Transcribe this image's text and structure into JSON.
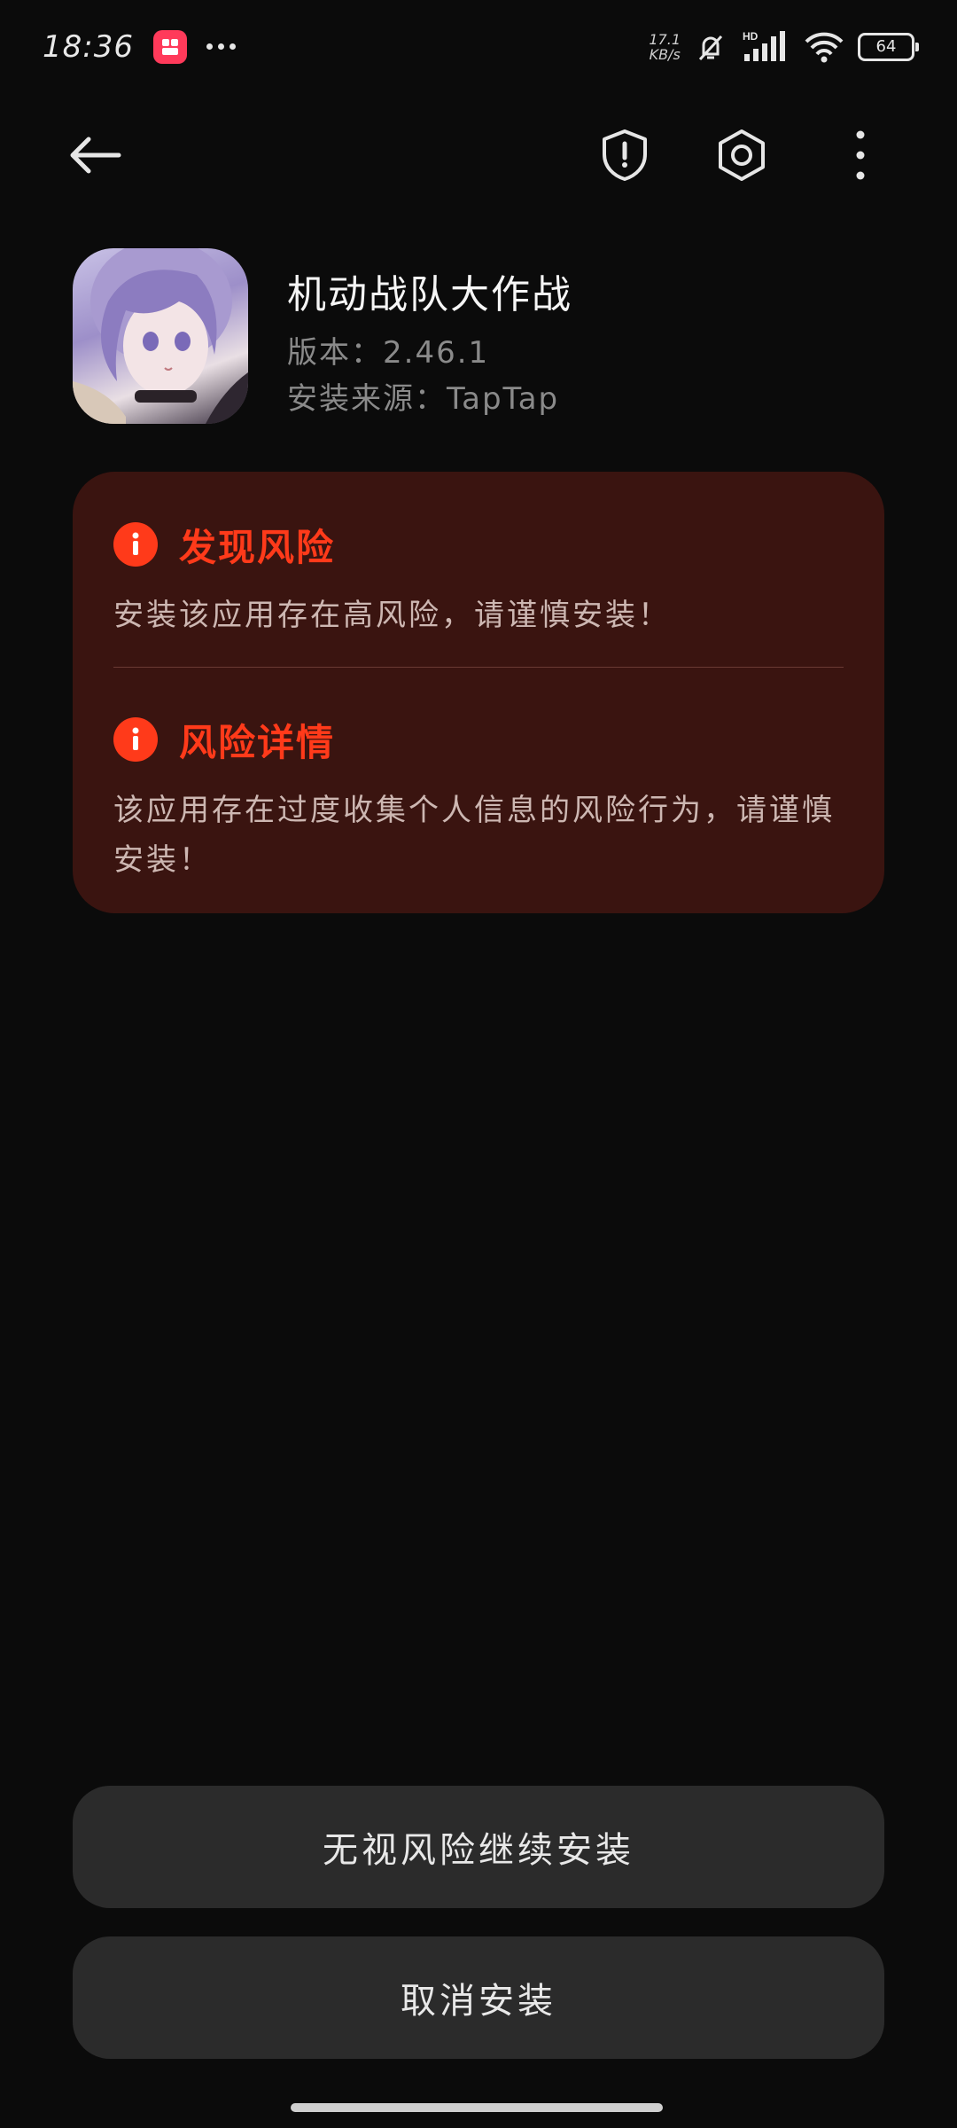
{
  "status_bar": {
    "time": "18:36",
    "app_icon": "app-notification-icon",
    "speed_value": "17.1",
    "speed_unit": "KB/s",
    "hd_label": "HD",
    "battery": "64"
  },
  "toolbar": {
    "back_icon": "arrow-left-icon",
    "shield_icon": "shield-alert-icon",
    "settings_icon": "settings-hexagon-icon",
    "more_icon": "more-vertical-icon"
  },
  "app": {
    "name": "机动战队大作战",
    "version": "版本：2.46.1",
    "source": "安装来源：TapTap"
  },
  "risk": {
    "found_title": "发现风险",
    "found_desc": "安装该应用存在高风险，请谨慎安装！",
    "detail_title": "风险详情",
    "detail_desc": "该应用存在过度收集个人信息的风险行为，请谨慎安装！",
    "accent_color": "#ff3a1a"
  },
  "buttons": {
    "continue": "无视风险继续安装",
    "cancel": "取消安装"
  }
}
